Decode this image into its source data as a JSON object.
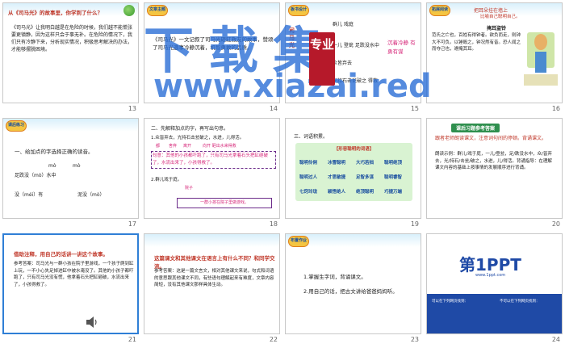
{
  "slides": [
    {
      "number": "13",
      "title": "从《司马光》的故事里，你学到了什么？",
      "body": "《司马光》让我明白越是在危险的时候，我们越不能慌张要更镇静，因为这样只会于事无补。在危险的情况下，我们只有冷静下来，分析现实情况，积极思考解决的办法，才能够摆脱困境。"
    },
    {
      "number": "14",
      "badge": "文章主题",
      "body": "《司马光》一文记叙了司马光砸缸救友的故事，赞颂了司马光遇事冷静沉着，机智勇敢的品质。"
    },
    {
      "number": "15",
      "badge": "板书设计",
      "lines": [
        "群儿 戏庭",
        "一儿 登瓮 足跌没水中",
        "众皆弃去",
        "光持石击瓮破之 得救"
      ],
      "side_label": "司马光",
      "right_label": "沉着冷静 有勇有谋"
    },
    {
      "number": "16",
      "badge": "拓展阅读",
      "heading": "把耳朵挂在墙上",
      "subheading": "比喻自己聪明自己。",
      "poem_title": "掩耳盗铃",
      "poem": "范氏之亡也，百姓有得钟者。欲负而走，则钟大不可负。以锤毁之，钟况然有音。恐人闻之而夺己也，遽掩其耳。"
    },
    {
      "number": "17",
      "badge": "课后练习",
      "item": "一、给加点的字选择正确的读音。",
      "pinyin_1": "mò",
      "pinyin_2": "mò",
      "line_1": "足跌没（mò）水中",
      "line_2": "没（méi）有",
      "line_3": "泥没（mò）"
    },
    {
      "number": "18",
      "item": "二、先解释加点的字，再写出句意。",
      "q1": "1.众皆弃去，光持石击瓮破之，水迸，儿得活。",
      "a1_label": "都",
      "a1_b": "舍弃",
      "a1_c": "离开",
      "a1_d": "向开 砸出水来得救",
      "meaning_1": "句意：其他的小孩都吓跑了，只有司马光拿着石头把缸砸破了，水流出来了，小孩得救了。",
      "q2": "2.群儿戏于庭。",
      "a2": "院子",
      "meaning_2": "一群小孩在院子里做游戏。"
    },
    {
      "number": "19",
      "item": "三、词语积累。",
      "table_title": "【形容聪明的词语】",
      "words": [
        "聪明伶俐",
        "冰雪聪明",
        "大巧若拙",
        "聪明绝顶",
        "聪明过人",
        "才思敏捷",
        "足智多谋",
        "聪明睿智",
        "七窍玲珑",
        "颖悟绝人",
        "绝顶聪明",
        "巧捷万端"
      ]
    },
    {
      "number": "20",
      "badge": "课后习题参考答案",
      "intro": "跟者老师朗读课文，注意词句间的停顿。背诵课文。",
      "body": "朗读示例：群儿/戏于庭，一儿/登瓮，足/跌没水中，众/皆弃去，光/持石/击瓮/破之，水迸，儿/得活。背诵指导：在理解课文内容的基础上按事情的发展顺序进行背诵。"
    },
    {
      "number": "21",
      "title": "借助注释，用自己的话讲一讲这个故事。",
      "body": "参考答案：司马光与一群小孩在院子里游戏，一个孩子爬到缸上玩，一不小心失足掉进缸中被水淹没了。其他的小孩子都吓跑了，只有司马光没有慌，他拿着石头把缸砸破，水流出来了，小孩得救了。"
    },
    {
      "number": "22",
      "title": "这篇课文和其他课文在语言上有什么不同？和同学交流。",
      "body": "参考答案：这是一篇文言文，相对其他课文来说，句式和词语的意思跟其他课文不同，有些语句理解起来有难度，文章内容简短，没有其他课文那样具体生动。"
    },
    {
      "number": "23",
      "badge": "布置作业",
      "hw_1": "1.掌握生字词，背诵课文。",
      "hw_2": "2.用自己的话，把古文讲给爸爸妈妈听。"
    },
    {
      "number": "24",
      "logo_text": "第1PPT",
      "logo_sub": "www.1ppt.com",
      "footer_left": "可以在下列网页找到：",
      "footer_right": "不可以在下列网页找到："
    }
  ],
  "watermark": {
    "cn": "下载集",
    "url": "www.xiazai.red",
    "stamp": "专业"
  },
  "colors": {
    "selected_border": "#2f7fd6",
    "red_title": "#c0392b",
    "pink": "#d6287a",
    "stamp_red": "#b6192a",
    "watermark_blue": "#2b6fd6"
  }
}
